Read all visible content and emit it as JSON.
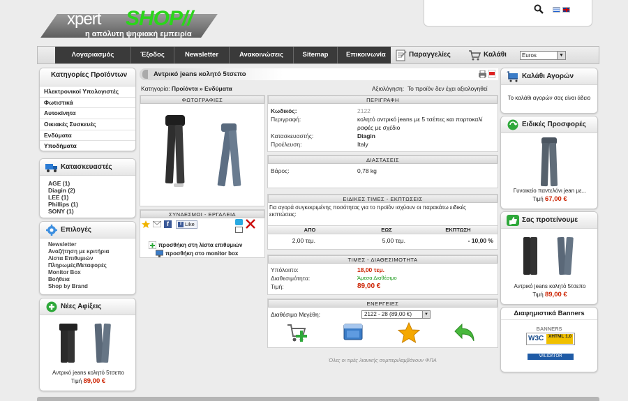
{
  "logo": {
    "xpert": "xpert",
    "shop": "SHOP//",
    "tagline": "η απόλυτη ψηφιακή εμπειρία"
  },
  "search": {
    "placeholder": ""
  },
  "nav": {
    "items": [
      "Λογαριασμός",
      "Έξοδος",
      "Newsletter",
      "Ανακοινώσεις",
      "Sitemap",
      "Επικοινωνία"
    ],
    "orders": "Παραγγελίες",
    "cart": "Καλάθι",
    "currency": "Euros"
  },
  "categories": {
    "title": "Κατηγορίες Προϊόντων",
    "items": [
      "Ηλεκτρονικοί Υπολογιστές",
      "Φωτιστικά",
      "Αυτοκίνητα",
      "Οικιακές Συσκευές",
      "Ενδύματα",
      "Υποδήματα"
    ]
  },
  "manufacturers": {
    "title": "Κατασκευαστές",
    "items": [
      "AGE (1)",
      "Diagin (2)",
      "LEE (1)",
      "Phillips (1)",
      "SONY (1)"
    ]
  },
  "options": {
    "title": "Επιλογές",
    "items": [
      "Newsletter",
      "Αναζήτηση με κριτήρια",
      "Λίστα Επιθυμιών",
      "Πληρωμές/Μεταφορές",
      "Monitor Box",
      "Βοήθεια",
      "Shop by Brand"
    ]
  },
  "new_arrivals": {
    "title": "Νέες Αφίξεις",
    "product": "Αντρικό jeans κολητό 5τσεπο",
    "price_label": "Τιμή",
    "price": "89,00 €"
  },
  "product": {
    "title": "Αντρικό jeans κολητό 5τσεπο",
    "breadcrumb_prefix": "Κατηγορία:",
    "breadcrumb": "Προϊόντα » Ενδύματα",
    "rating_label": "Αξιολόγηση:",
    "rating_text": "Το προϊόν δεν έχει αξιολογηθεί",
    "photos_header": "ΦΩΤΟΓΡΑΦΙΕΣ",
    "links_header": "ΣΥΝΔΕΣΜΟΙ - ΕΡΓΑΛΕΙΑ",
    "like": "Like",
    "add_wishlist": "προσθήκη στη λίστα επιθυμιών",
    "add_monitor": "προσθήκη στο monitor box",
    "desc_header": "ΠΕΡΙΓΡΑΦΗ",
    "code_label": "Κωδικός:",
    "code": "2122",
    "desc_label": "Περιγραφή:",
    "desc": "κολητό αντρικό jeans με 5 τσέπες και πορτοκαλί ραφές με σχέδιο",
    "maker_label": "Κατασκευαστής:",
    "maker": "Diagin",
    "origin_label": "Προέλευση:",
    "origin": "Italy",
    "dims_header": "ΔΙΑΣΤΑΣΕΙΣ",
    "weight_label": "Βάρος:",
    "weight": "0,78 kg",
    "special_header": "ΕΙΔΙΚΕΣ ΤΙΜΕΣ - ΕΚΠΤΩΣΕΙΣ",
    "special_text": "Για αγορά συγκεκριμένης ποσότητας για το προϊόν ισχύουν οι παρακάτω ειδικές εκπτώσεις:",
    "discount_cols": [
      "ΑΠΟ",
      "ΕΩΣ",
      "ΕΚΠΤΩΣΗ"
    ],
    "discount_row": [
      "2,00 τεμ.",
      "5,00 τεμ.",
      "- 10,00 %"
    ],
    "prices_header": "ΤΙΜΕΣ - ΔΙΑΘΕΣΙΜΟΤΗΤΑ",
    "stock_label": "Υπόλοιπο:",
    "stock": "18,00 τεμ.",
    "avail_label": "Διαθεσιμότητα:",
    "avail": "Άμεσα Διαθέσιμο",
    "price_label": "Τιμή:",
    "price": "89,00 €",
    "actions_header": "ΕΝΕΡΓΕΙΕΣ",
    "sizes_label": "Διαθέσιμα Μεγέθη:",
    "size_value": "2122 - 28 (89,00 €)",
    "vat_note": "Όλες οι τιμές λιανικής συμπεριλαμβάνουν ΦΠΑ"
  },
  "cart_box": {
    "title": "Καλάθι Αγορών",
    "text": "Το καλάθι αγορών σας είναι άδειο"
  },
  "specials": {
    "title": "Ειδικές Προσφορές",
    "product": "Γυναικείο παντελόνι jean με...",
    "price_label": "Τιμή",
    "price": "67,00 €"
  },
  "recommend": {
    "title": "Σας προτείνουμε",
    "product": "Αντρικό jeans κολητό 5τσεπο",
    "price_label": "Τιμή",
    "price": "89,00 €"
  },
  "banners": {
    "title": "Διαφημιστικά Banners",
    "label": "BANNERS",
    "w3c": "W3C",
    "xhtml": "XHTML 1.0",
    "validator": "VALIDATOR"
  },
  "colors": {
    "accent_red": "#cc2200",
    "accent_green": "#2bd51b",
    "nav_dark": "#3a3a3a"
  }
}
